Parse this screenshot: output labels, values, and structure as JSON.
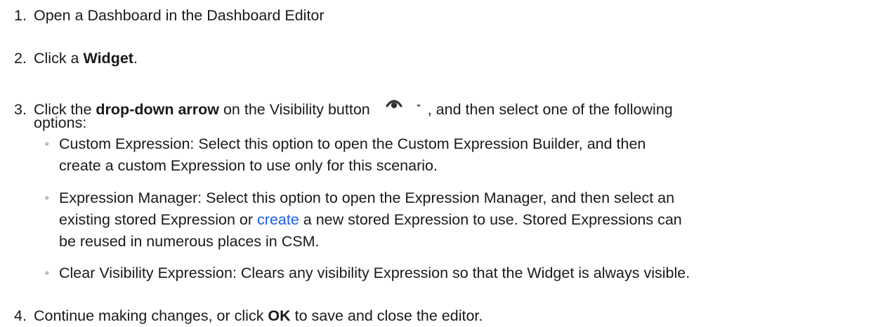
{
  "steps": [
    {
      "number": "1.",
      "text": "Open a Dashboard in the Dashboard Editor"
    },
    {
      "number": "2.",
      "prefix": "Click a ",
      "bold": "Widget",
      "suffix": "."
    },
    {
      "number": "3.",
      "prefix": "Click the ",
      "bold": "drop-down arrow",
      "middle": " on the Visibility button ",
      "suffix": ", and then select one of the following",
      "continuation": "options:",
      "icon": "visibility-eye-icon",
      "options": [
        {
          "line1": "Custom Expression: Select this option to open the Custom Expression Builder, and then",
          "line2": "create a custom Expression to use only for this scenario."
        },
        {
          "line1": "Expression Manager: Select this option to open the Expression Manager, and then select an",
          "line2_prefix": "existing stored Expression or ",
          "line2_link": "create",
          "line2_suffix": " a new stored Expression to use. Stored Expressions can",
          "line3": "be reused in numerous places in CSM."
        },
        {
          "line1": "Clear Visibility Expression: Clears any visibility Expression so that the Widget is always visible."
        }
      ]
    },
    {
      "number": "4.",
      "prefix": "Continue making changes, or click ",
      "bold": "OK",
      "suffix": " to save and close the editor."
    }
  ],
  "colors": {
    "text": "#1a1a1a",
    "link": "#1a5ce6",
    "icon": "#333333"
  }
}
